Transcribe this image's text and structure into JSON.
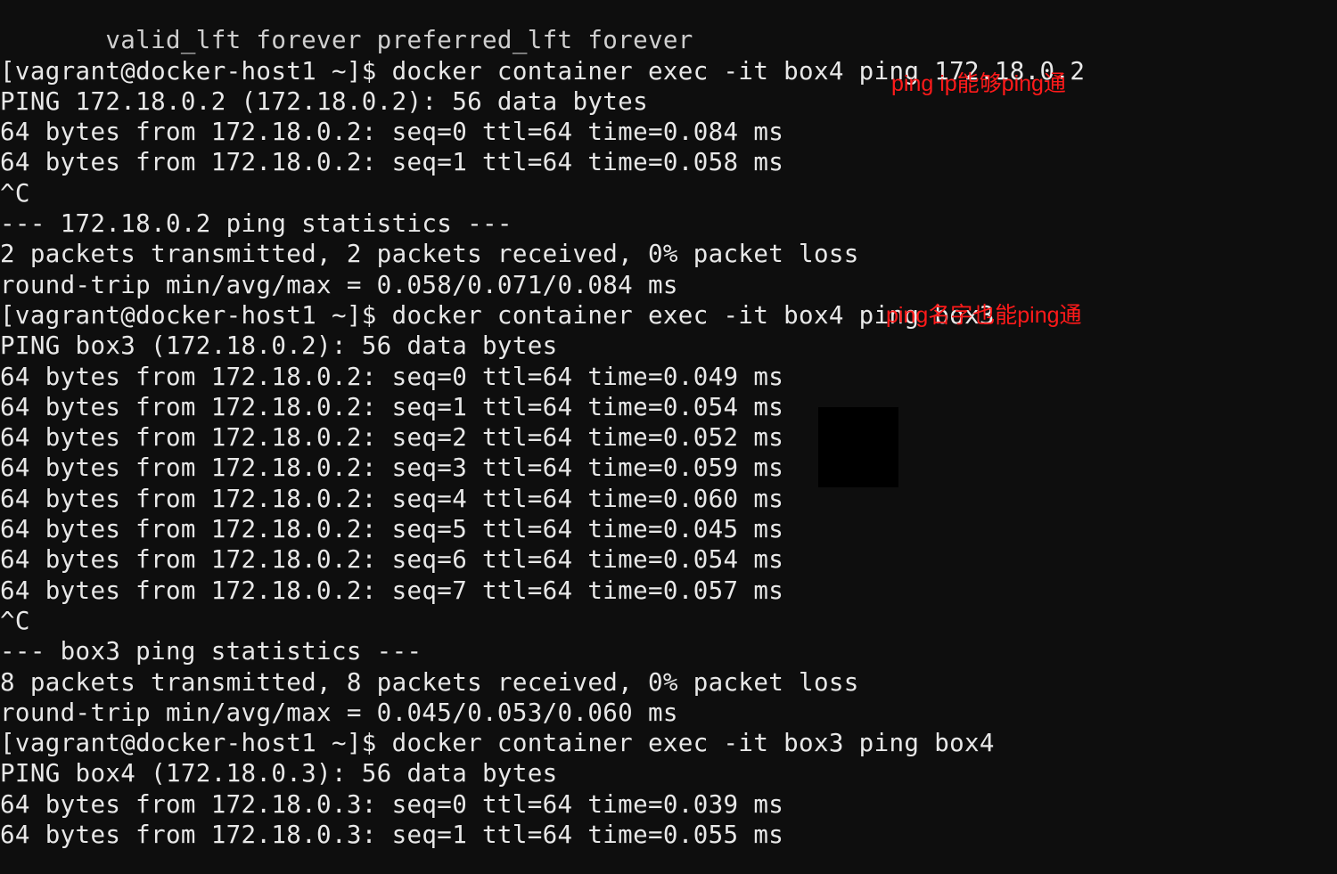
{
  "terminal": {
    "lines": [
      "       valid_lft forever preferred_lft forever",
      "[vagrant@docker-host1 ~]$ docker container exec -it box4 ping 172.18.0.2",
      "PING 172.18.0.2 (172.18.0.2): 56 data bytes",
      "64 bytes from 172.18.0.2: seq=0 ttl=64 time=0.084 ms",
      "64 bytes from 172.18.0.2: seq=1 ttl=64 time=0.058 ms",
      "^C",
      "--- 172.18.0.2 ping statistics ---",
      "2 packets transmitted, 2 packets received, 0% packet loss",
      "round-trip min/avg/max = 0.058/0.071/0.084 ms",
      "[vagrant@docker-host1 ~]$ docker container exec -it box4 ping box3",
      "PING box3 (172.18.0.2): 56 data bytes",
      "64 bytes from 172.18.0.2: seq=0 ttl=64 time=0.049 ms",
      "64 bytes from 172.18.0.2: seq=1 ttl=64 time=0.054 ms",
      "64 bytes from 172.18.0.2: seq=2 ttl=64 time=0.052 ms",
      "64 bytes from 172.18.0.2: seq=3 ttl=64 time=0.059 ms",
      "64 bytes from 172.18.0.2: seq=4 ttl=64 time=0.060 ms",
      "64 bytes from 172.18.0.2: seq=5 ttl=64 time=0.045 ms",
      "64 bytes from 172.18.0.2: seq=6 ttl=64 time=0.054 ms",
      "64 bytes from 172.18.0.2: seq=7 ttl=64 time=0.057 ms",
      "^C",
      "--- box3 ping statistics ---",
      "8 packets transmitted, 8 packets received, 0% packet loss",
      "round-trip min/avg/max = 0.045/0.053/0.060 ms",
      "[vagrant@docker-host1 ~]$ docker container exec -it box3 ping box4",
      "PING box4 (172.18.0.3): 56 data bytes",
      "64 bytes from 172.18.0.3: seq=0 ttl=64 time=0.039 ms",
      "64 bytes from 172.18.0.3: seq=1 ttl=64 time=0.055 ms"
    ]
  },
  "annotations": {
    "a1": "ping ip能够ping通",
    "a2": "ping名字也能ping通"
  }
}
